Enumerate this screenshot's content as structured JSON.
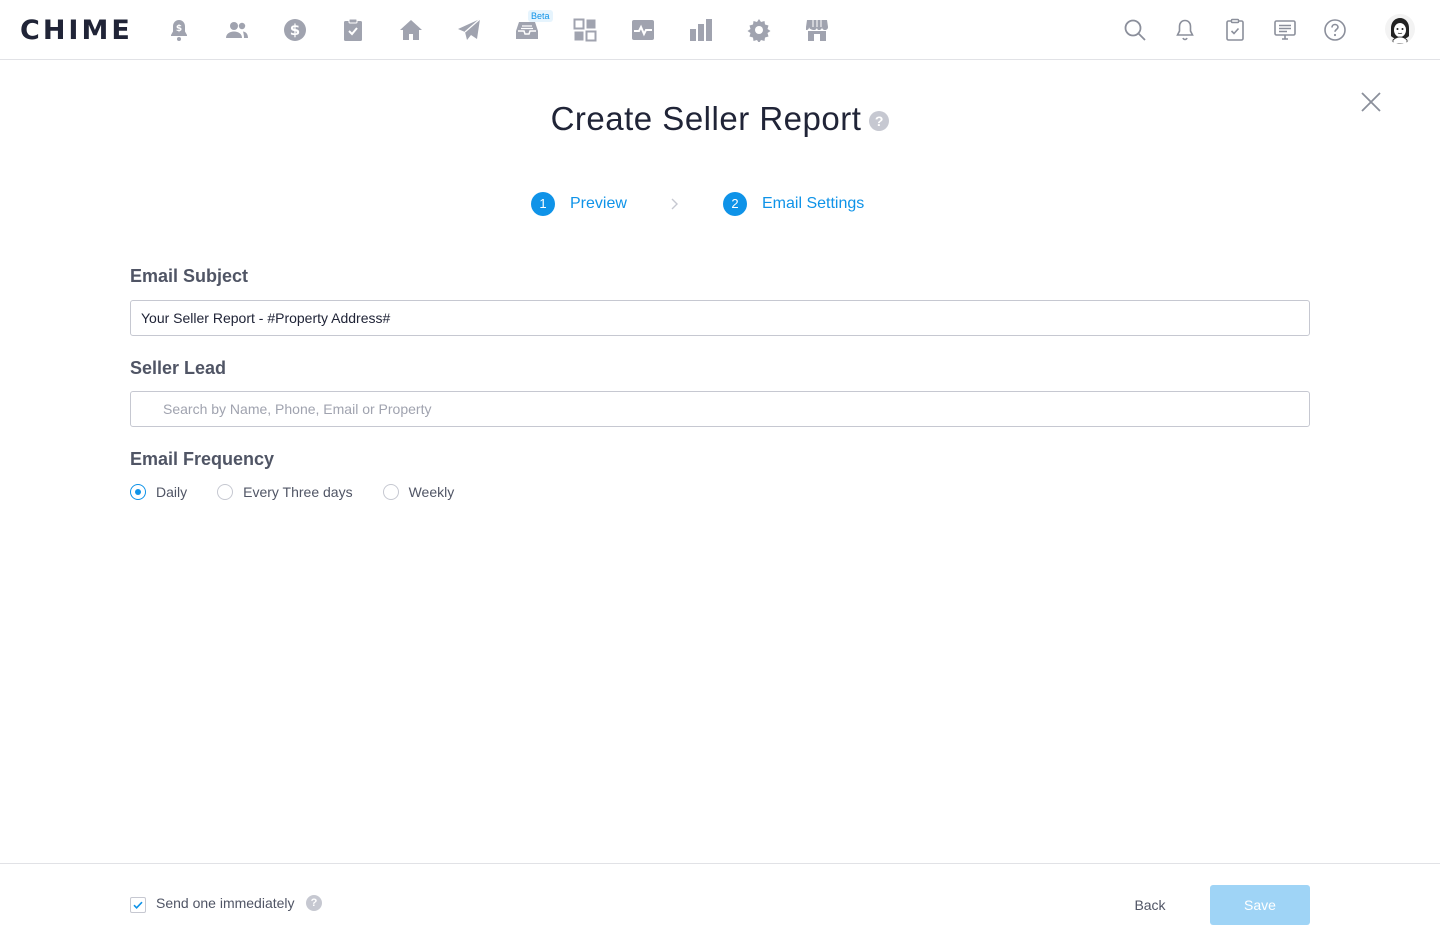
{
  "app": {
    "logo_text": "CHIME"
  },
  "nav": {
    "icons": [
      "alert-bell-icon",
      "people-icon",
      "dollar-icon",
      "clipboard-check-icon",
      "home-icon",
      "paper-plane-icon",
      "inbox-icon",
      "dashboard-grid-icon",
      "activity-icon",
      "bar-chart-icon",
      "gear-icon",
      "store-icon"
    ],
    "beta_badge": "Beta",
    "right_icons": [
      "search-icon",
      "notification-bell-icon",
      "task-clipboard-icon",
      "message-screen-icon",
      "help-icon"
    ]
  },
  "modal": {
    "title": "Create Seller Report",
    "help_glyph": "?",
    "steps": [
      {
        "number": "1",
        "label": "Preview"
      },
      {
        "number": "2",
        "label": "Email Settings"
      }
    ]
  },
  "form": {
    "email_subject_label": "Email Subject",
    "email_subject_value": "Your Seller Report - #Property Address#",
    "seller_lead_label": "Seller Lead",
    "seller_lead_placeholder": "Search by Name, Phone, Email or Property",
    "frequency_label": "Email Frequency",
    "frequency_options": [
      "Daily",
      "Every Three days",
      "Weekly"
    ],
    "frequency_selected": "Daily"
  },
  "footer": {
    "send_immediately_label": "Send one immediately",
    "send_immediately_checked": true,
    "help_glyph": "?",
    "back_label": "Back",
    "save_label": "Save"
  },
  "colors": {
    "accent": "#0f93e8",
    "save_disabled": "#9fd4f6",
    "icon_gray": "#a0a3af",
    "text_dark": "#202437",
    "text_mid": "#505565"
  }
}
